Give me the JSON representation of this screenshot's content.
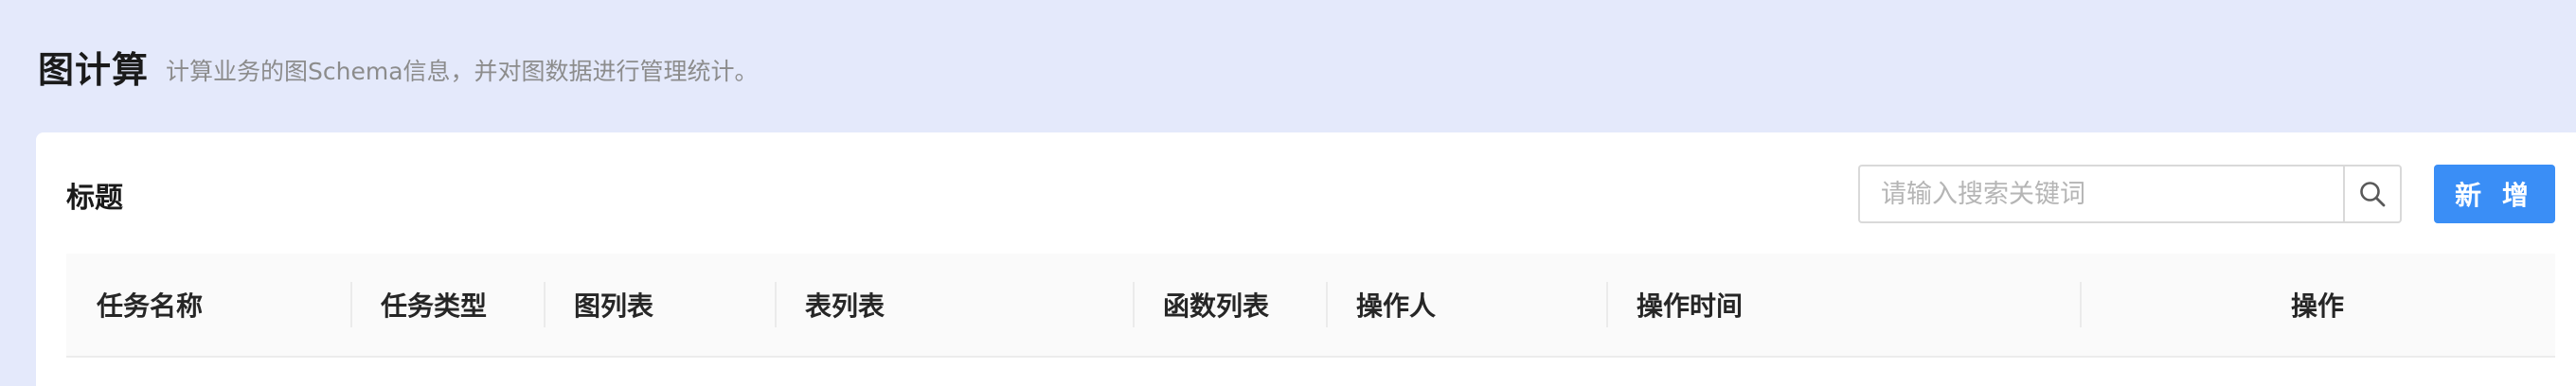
{
  "header": {
    "title": "图计算",
    "subtitle": "计算业务的图Schema信息，并对图数据进行管理统计。"
  },
  "card": {
    "title": "标题",
    "search": {
      "placeholder": "请输入搜索关键词",
      "value": "",
      "icon": "search-icon"
    },
    "add_label": "新 增",
    "accent_color": "#3a8ef6"
  },
  "table": {
    "columns": [
      "任务名称",
      "任务类型",
      "图列表",
      "表列表",
      "函数列表",
      "操作人",
      "操作时间",
      "操作"
    ]
  }
}
